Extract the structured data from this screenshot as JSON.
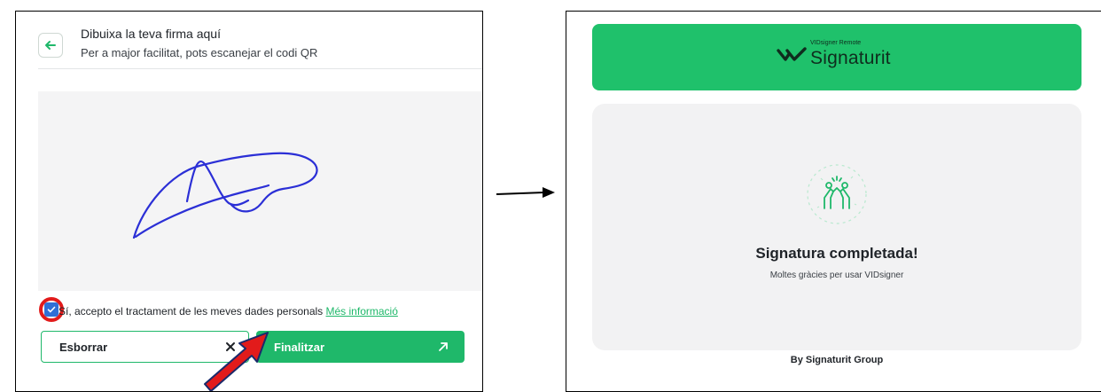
{
  "draw_panel": {
    "title": "Dibuixa la teva firma aquí",
    "subtitle": "Per a major facilitat, pots escanejar el codi QR",
    "consent_text": "Sí, accepto el tractament de les meves dades personals",
    "consent_link": "Més informació",
    "consent_checked": true,
    "clear_button": "Esborrar",
    "finish_button": "Finalitzar",
    "icons": {
      "back": "arrow-left-icon",
      "clear": "close-icon",
      "finish": "arrow-up-right-icon"
    }
  },
  "result_panel": {
    "brand_small": "VIDsigner Remote",
    "brand_name": "Signaturit",
    "success_title": "Signatura completada!",
    "success_subtitle": "Moltes gràcies per usar VIDsigner",
    "footer": "By Signaturit Group",
    "icon": "high-five-icon"
  },
  "colors": {
    "accent_green": "#1fb86a",
    "banner_green": "#1fc16b",
    "highlight_red": "#e21b1b",
    "checkbox_blue": "#2f6fd6",
    "signature_blue": "#2b2fd6"
  }
}
